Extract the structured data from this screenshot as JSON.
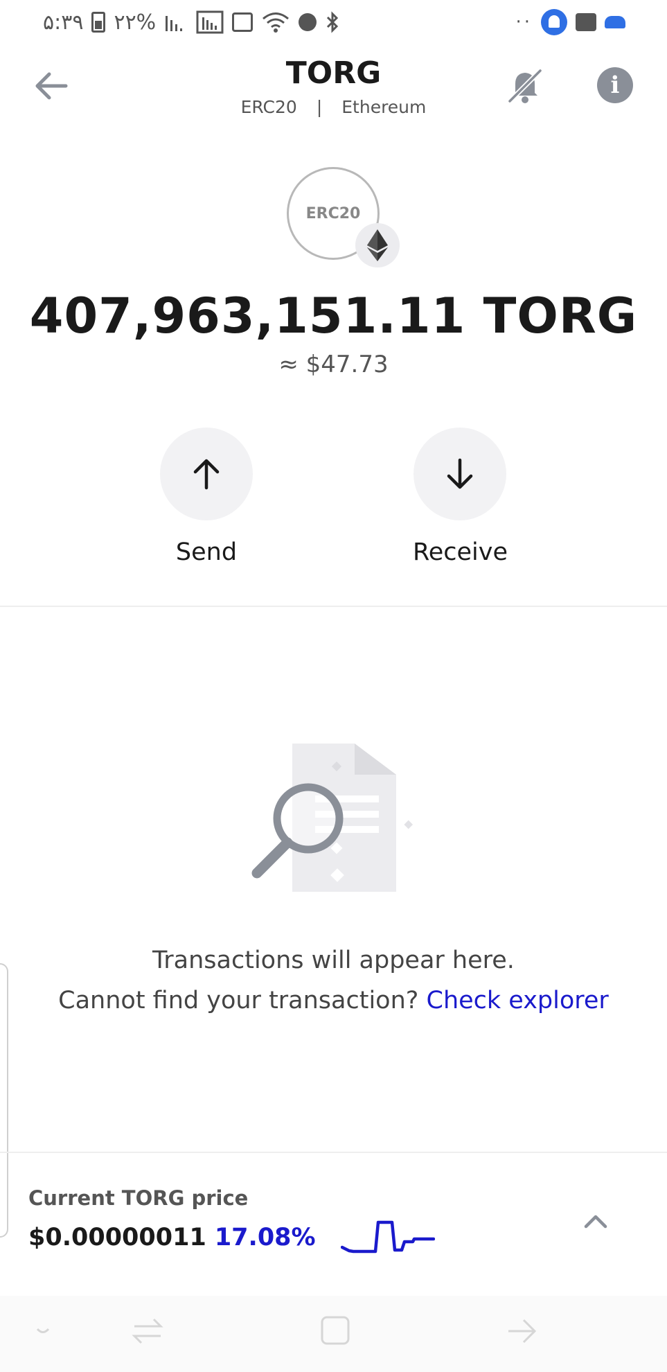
{
  "status_bar": {
    "time": "۵:۳۹",
    "battery": "۲۲%"
  },
  "header": {
    "title": "TORG",
    "token_standard": "ERC20",
    "separator": "|",
    "network": "Ethereum"
  },
  "token": {
    "logo_text": "ERC20",
    "balance": "407,963,151.11 TORG",
    "fiat_value": "≈ $47.73"
  },
  "actions": {
    "send_label": "Send",
    "receive_label": "Receive"
  },
  "empty_state": {
    "line1": "Transactions will appear here.",
    "line2_prefix": "Cannot find your transaction?",
    "link_label": "Check explorer"
  },
  "price_panel": {
    "label": "Current TORG price",
    "price": "$0.00000011",
    "change": "17.08%"
  },
  "colors": {
    "accent_blue": "#1a1acc",
    "notification_blue": "#2f6fe4",
    "icon_gray": "#8a8f98",
    "action_bg": "#f2f2f4"
  },
  "icons": {
    "back": "arrow-left-icon",
    "notifications_off": "bell-off-icon",
    "info": "info-icon",
    "network": "ethereum-icon",
    "send": "arrow-up-icon",
    "receive": "arrow-down-icon",
    "empty": "document-search-icon",
    "collapse": "chevron-up-icon"
  }
}
